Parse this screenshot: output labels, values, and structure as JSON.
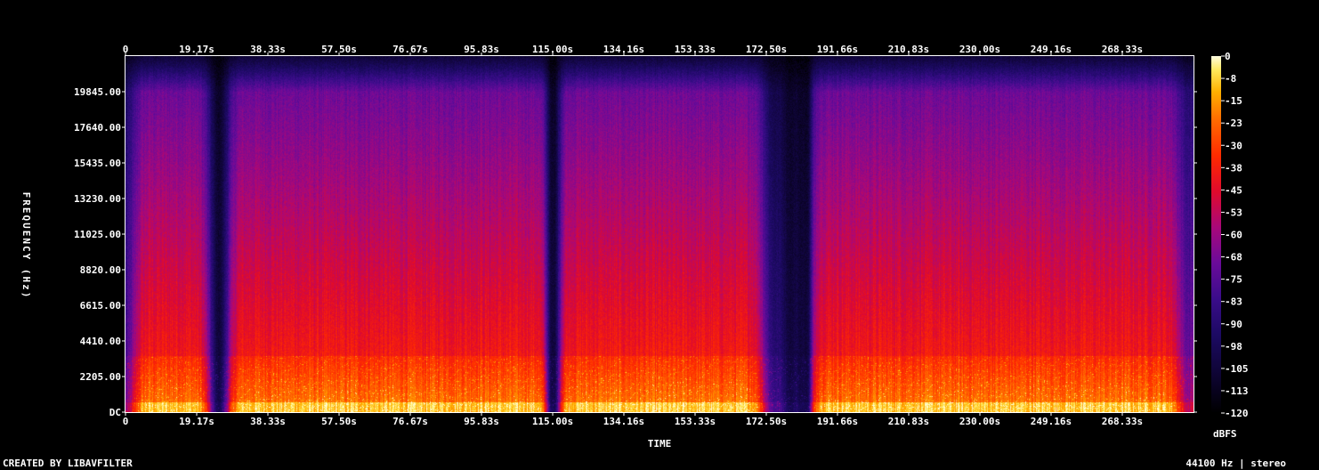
{
  "chart_data": {
    "type": "heatmap",
    "xlabel": "TIME",
    "ylabel": "FREQUENCY (Hz)",
    "x_ticks": [
      "0",
      "19.17s",
      "38.33s",
      "57.50s",
      "76.67s",
      "95.83s",
      "115.00s",
      "134.16s",
      "153.33s",
      "172.50s",
      "191.66s",
      "210.83s",
      "230.00s",
      "249.16s",
      "268.33s"
    ],
    "x_tick_values": [
      0,
      19.17,
      38.33,
      57.5,
      76.67,
      95.83,
      115.0,
      134.16,
      153.33,
      172.5,
      191.66,
      210.83,
      230.0,
      249.16,
      268.33
    ],
    "xlim": [
      0,
      287.5
    ],
    "y_ticks": [
      "DC",
      "2205.00",
      "4410.00",
      "6615.00",
      "8820.00",
      "11025.00",
      "13230.00",
      "15435.00",
      "17640.00",
      "19845.00"
    ],
    "y_tick_values": [
      0,
      2205,
      4410,
      6615,
      8820,
      11025,
      13230,
      15435,
      17640,
      19845
    ],
    "ylim": [
      0,
      22050
    ],
    "colorbar": {
      "label": "dBFS",
      "ticks": [
        "0",
        "-8",
        "-15",
        "-23",
        "-30",
        "-38",
        "-45",
        "-53",
        "-60",
        "-68",
        "-75",
        "-83",
        "-90",
        "-98",
        "-105",
        "-113",
        "-120"
      ],
      "range": [
        -120,
        0
      ]
    },
    "colors": {
      "background": "#000000",
      "text": "#ffffff",
      "frame": "#ffffff"
    }
  },
  "footer": {
    "credit": "CREATED BY LIBAVFILTER",
    "info": "44100 Hz | stereo"
  }
}
